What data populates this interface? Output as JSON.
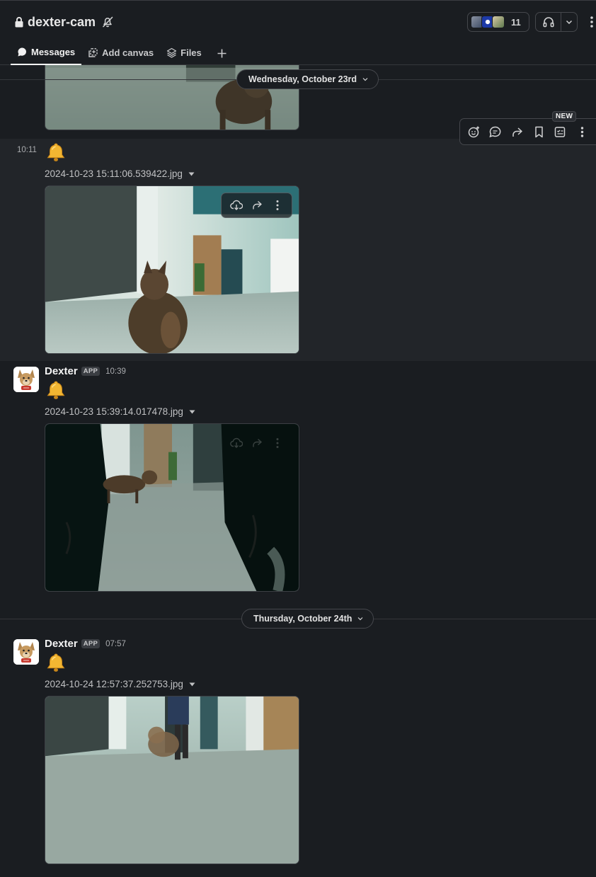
{
  "header": {
    "channel_name": "dexter-cam",
    "member_count": "11",
    "tabs": [
      {
        "label": "Messages",
        "active": true,
        "icon": "chat-bubble-icon"
      },
      {
        "label": "Add canvas",
        "active": false,
        "icon": "canvas-icon"
      },
      {
        "label": "Files",
        "active": false,
        "icon": "layers-icon"
      }
    ]
  },
  "day_separators": [
    {
      "label": "Wednesday, October 23rd"
    },
    {
      "label": "Thursday, October 24th"
    }
  ],
  "message_actions": {
    "new_badge": "NEW",
    "icons": [
      "add-reaction-icon",
      "reply-thread-icon",
      "forward-icon",
      "bookmark-icon",
      "add-to-list-icon",
      "more-actions-icon"
    ]
  },
  "messages": [
    {
      "time": "10:11",
      "sender": "",
      "emoji": "bell",
      "filename": "2024-10-23 15:11:06.539422.jpg"
    },
    {
      "time": "10:39",
      "sender": "Dexter",
      "badge": "APP",
      "emoji": "bell",
      "filename": "2024-10-23 15:39:14.017478.jpg"
    },
    {
      "time": "07:57",
      "sender": "Dexter",
      "badge": "APP",
      "emoji": "bell",
      "filename": "2024-10-24 12:57:37.252753.jpg"
    }
  ],
  "colors": {
    "background": "#1a1d21",
    "hover_row": "#222529",
    "text_primary": "#f4f4f4",
    "text_secondary": "#a9abae",
    "bell": "#f2b632"
  }
}
